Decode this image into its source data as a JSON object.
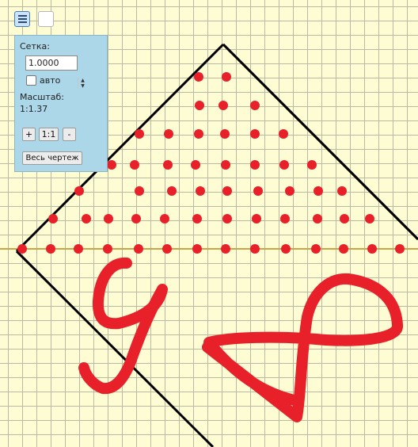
{
  "toolbar": {
    "menu_icon": "hamburger-icon",
    "blank_icon": "blank-square-icon"
  },
  "panel": {
    "grid_label": "Сетка:",
    "grid_value": "1.0000",
    "auto_label": "авто",
    "auto_checked": false,
    "scale_label": "Масштаб:",
    "scale_value": "1:1.37",
    "zoom_in": "+",
    "zoom_reset": "1:1",
    "zoom_out": "-",
    "fit_button": "Весь чертеж"
  },
  "colors": {
    "background": "#fdfcd2",
    "grid_lines": "#b9b9a6",
    "axis": "#c9a54a",
    "diamond": "#000000",
    "points": "#e8202a",
    "scribble": "#e8202a",
    "panel": "#acd7e8"
  }
}
